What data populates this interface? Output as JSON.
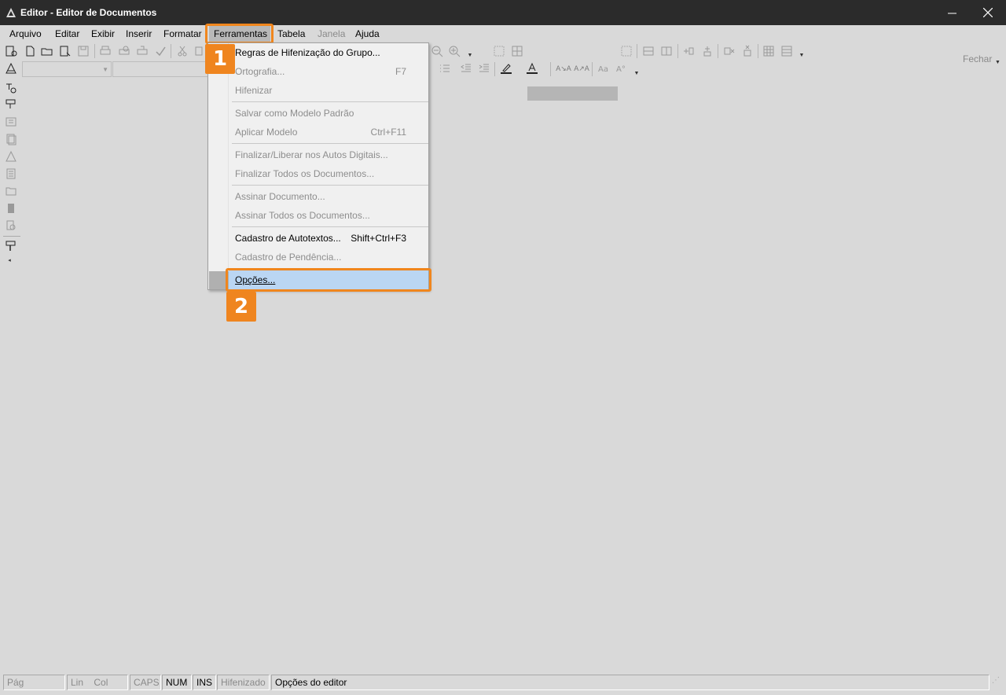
{
  "window": {
    "title": "Editor - Editor de Documentos",
    "minimize": "—",
    "close": "✕"
  },
  "menubar": {
    "items": [
      {
        "label": "Arquivo",
        "enabled": true
      },
      {
        "label": "Editar",
        "enabled": true
      },
      {
        "label": "Exibir",
        "enabled": true
      },
      {
        "label": "Inserir",
        "enabled": true
      },
      {
        "label": "Formatar",
        "enabled": true
      },
      {
        "label": "Ferramentas",
        "enabled": true,
        "open": true
      },
      {
        "label": "Tabela",
        "enabled": true
      },
      {
        "label": "Janela",
        "enabled": false
      },
      {
        "label": "Ajuda",
        "enabled": true
      }
    ],
    "fechar": "Fechar"
  },
  "dropdown": {
    "items": [
      {
        "label": "Regras de Hifenização do Grupo...",
        "shortcut": "",
        "enabled": true
      },
      {
        "label": "Ortografia...",
        "shortcut": "F7",
        "enabled": false
      },
      {
        "label": "Hifenizar",
        "shortcut": "",
        "enabled": false
      },
      {
        "label": "Salvar como Modelo Padrão",
        "shortcut": "",
        "enabled": false
      },
      {
        "label": "Aplicar Modelo",
        "shortcut": "Ctrl+F11",
        "enabled": false
      },
      {
        "label": "Finalizar/Liberar nos Autos Digitais...",
        "shortcut": "",
        "enabled": false
      },
      {
        "label": "Finalizar Todos os Documentos...",
        "shortcut": "",
        "enabled": false
      },
      {
        "label": "Assinar Documento...",
        "shortcut": "",
        "enabled": false
      },
      {
        "label": "Assinar Todos os Documentos...",
        "shortcut": "",
        "enabled": false
      },
      {
        "label": "Cadastro de Autotextos...",
        "shortcut": "Shift+Ctrl+F3",
        "enabled": true
      },
      {
        "label": "Cadastro de Pendência...",
        "shortcut": "",
        "enabled": false
      },
      {
        "label": "Opções...",
        "shortcut": "",
        "enabled": true,
        "highlighted": true
      }
    ]
  },
  "callouts": {
    "step1": "1",
    "step2": "2",
    "color": "#ef851f"
  },
  "statusbar": {
    "pag": "Pág",
    "lin": "Lin",
    "col": "Col",
    "caps": "CAPS",
    "num": "NUM",
    "ins": "INS",
    "hifenizado": "Hifenizado",
    "message": "Opções do editor"
  },
  "colors": {
    "titlebar": "#2b2b2b",
    "background": "#d9d9d9",
    "menu_highlight": "#bad6f3",
    "accent": "#ef851f"
  }
}
